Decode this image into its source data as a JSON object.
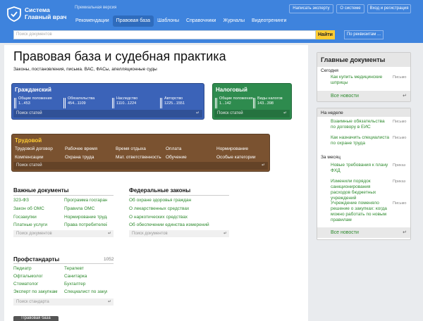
{
  "header": {
    "logo_line1": "Система",
    "logo_line2": "Главный врач",
    "premium": "Премиальная версия",
    "nav": [
      "Рекомендации",
      "Правовая база",
      "Шаблоны",
      "Справочники",
      "Журналы",
      "Видеотренинги"
    ],
    "active_nav": "Правовая база",
    "write_expert": "Написать эксперту",
    "about": "О системе",
    "login": "Вход и регистрация"
  },
  "search": {
    "placeholder": "Поиск документов",
    "button": "Найти",
    "by_details": "По реквизитам ..."
  },
  "page": {
    "title": "Правовая база и судебная практика",
    "subtitle": "Законы, постановления, письма. ВАС, ФАСы, апелляционные суды"
  },
  "civil": {
    "title": "Гражданский",
    "cells": [
      {
        "l1": "Общие положения",
        "l2": "1...453"
      },
      {
        "l1": "Обязательства",
        "l2": "454...1109"
      },
      {
        "l1": "Наследство",
        "l2": "1110...1224"
      },
      {
        "l1": "Авторство",
        "l2": "1225...1551"
      }
    ],
    "search": "Поиск статей"
  },
  "tax": {
    "title": "Налоговый",
    "cells": [
      {
        "l1": "Общие положения",
        "l2": "1...142"
      },
      {
        "l1": "Виды налогов",
        "l2": "143...398"
      }
    ],
    "search": "Поиск статей"
  },
  "labour": {
    "title": "Трудовой",
    "row1": [
      "Трудовой договор",
      "Рабочее время",
      "Время отдыха",
      "Оплата",
      "Нормирование"
    ],
    "row2": [
      "Компенсации",
      "Охрана труда",
      "Мат. ответственность",
      "Обучение",
      "Особые категории"
    ],
    "search": "Поиск статей"
  },
  "important": {
    "title": "Важные документы",
    "col1": [
      "323-ФЗ",
      "Закон об ОМС",
      "Госзакупки",
      "Платные услуги"
    ],
    "col2": [
      "Программа госгарант",
      "Правила ОМС",
      "Нормирование труда",
      "Права потребителей"
    ],
    "search": "Поиск документов"
  },
  "federal": {
    "title": "Федеральные законы",
    "items": [
      "Об охране здоровья граждан",
      "О лекарственных средствах",
      "О наркотических средствах",
      "Об обеспечении единства измерений"
    ],
    "search": "Поиск документов"
  },
  "prof": {
    "title": "Профстандарты",
    "count": "1052",
    "col1": [
      "Педиатр",
      "Офтальмолог",
      "Стоматолог",
      "Эксперт по закупкам"
    ],
    "col2": [
      "Терапевт",
      "Санитарка",
      "Бухгалтер",
      "Специалист по закупкам"
    ],
    "search": "Поиск стандарта"
  },
  "bottom_button": "Правовая база",
  "main_docs": {
    "title": "Главные документы",
    "today": "Сегодня",
    "items": [
      {
        "text": "Как купить медицинские шприцы",
        "tag": "Письмо"
      }
    ],
    "all_news": "Все новости"
  },
  "side2": {
    "week": "На неделе",
    "week_items": [
      {
        "text": "Взаимные обязательства по договору в ЕИС",
        "tag": "Письмо"
      },
      {
        "text": "Как назначить специалиста по охране труда",
        "tag": "Письмо"
      }
    ],
    "month": "За месяц",
    "month_items": [
      {
        "text": "Новые требования к плану ФХД",
        "tag": "Приказ"
      },
      {
        "text": "Изменили порядок санкционирования расходов бюджетных учреждений",
        "tag": "Приказ"
      },
      {
        "text": "Учреждение поменяло решение о закупках: когда можно работать по новым правилам",
        "tag": "Письмо"
      }
    ],
    "all_news": "Все новости"
  },
  "colors": {
    "header": "#3e83dd",
    "civil": "#3b63b8",
    "tax": "#2e8b4e",
    "labour": "#7a5230",
    "link": "#2d8a2d",
    "search_button": "#ffcc33"
  }
}
